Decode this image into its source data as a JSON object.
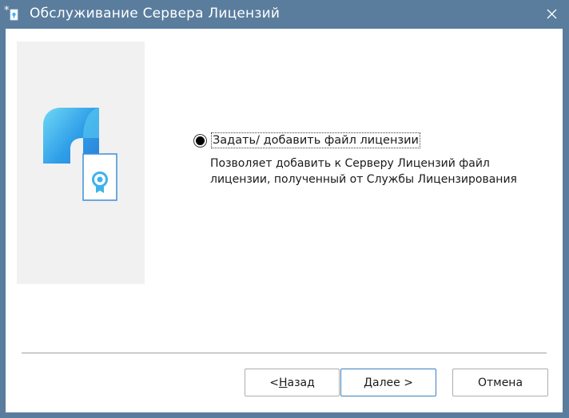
{
  "window": {
    "title": "Обслуживание Сервера Лицензий"
  },
  "option": {
    "label": "Задать/ добавить файл лицензии",
    "selected": true,
    "description": "Позволяет добавить к Серверу Лицензий файл лицензии, полученный от Службы Лицензирования"
  },
  "buttons": {
    "back": {
      "prefix": "< ",
      "mnemonic": "Н",
      "rest": "азад"
    },
    "next": {
      "mnemonic": "Д",
      "rest": "алее >"
    },
    "cancel": "Отмена"
  },
  "icons": {
    "app": "license-app-icon",
    "close": "close-icon",
    "logo": "license-logo-icon",
    "certificate": "certificate-icon"
  },
  "colors": {
    "titlebar": "#5a7d9e",
    "panel": "#f1f1f1",
    "accent_blue": "#3c7fc1",
    "logo_blue": "#2f9ee8",
    "logo_cyan": "#5fd0f3"
  }
}
